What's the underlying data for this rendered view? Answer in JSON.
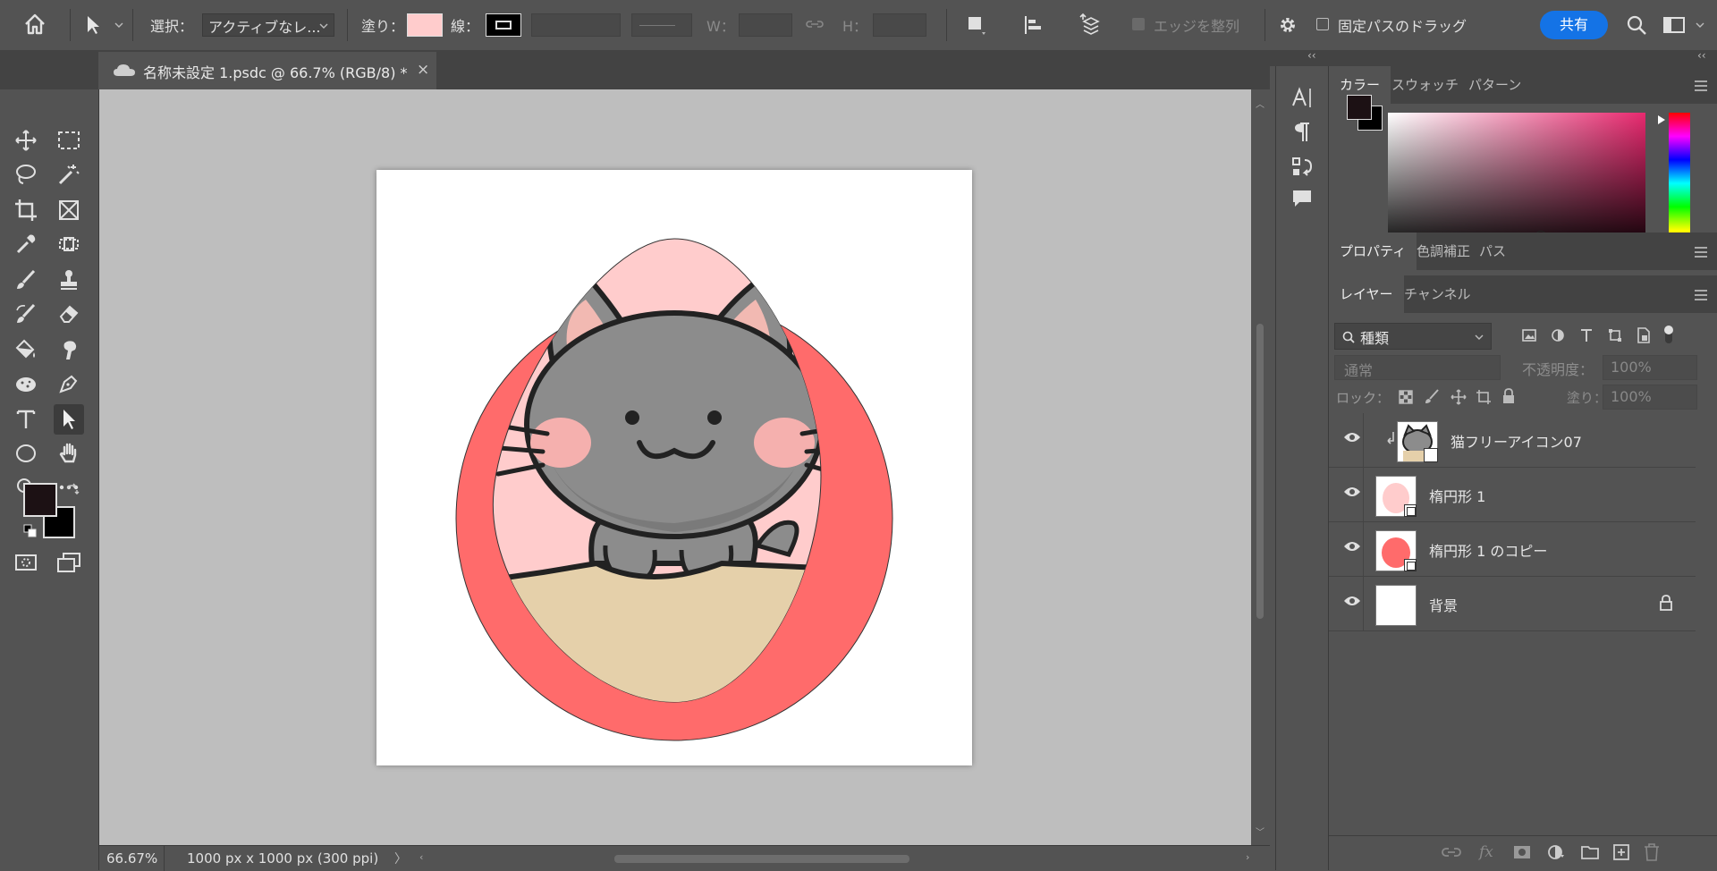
{
  "options_bar": {
    "select_label": "選択：",
    "select_value": "アクティブなレ...",
    "fill_label": "塗り：",
    "fill_color": "#ffcccc",
    "stroke_label": "線：",
    "w_label": "W：",
    "h_label": "H：",
    "align_edges_label": "エッジを整列",
    "constrain_path_label": "固定パスのドラッグ",
    "share_label": "共有"
  },
  "document": {
    "tab_title": "名称未設定 1.psdc @ 66.7% (RGB/8) *",
    "close_glyph": "×"
  },
  "status": {
    "zoom": "66.67%",
    "doc_info": "1000 px x 1000 px (300 ppi)",
    "arrow": "〉"
  },
  "color_panel": {
    "tabs": [
      "カラー",
      "スウォッチ",
      "パターン"
    ],
    "foreground": "#1c1114",
    "background": "#000000",
    "hue_color": "#e8296f"
  },
  "properties_panel": {
    "tabs": [
      "プロパティ",
      "色調補正",
      "パス"
    ]
  },
  "layers_panel": {
    "tabs": [
      "レイヤー",
      "チャンネル"
    ],
    "filter_label": "種類",
    "blend_mode": "通常",
    "opacity_label": "不透明度：",
    "opacity_value": "100%",
    "lock_label": "ロック：",
    "fill_label": "塗り：",
    "fill_value": "100%",
    "layers": [
      {
        "name": "猫フリーアイコン07",
        "clipped": true
      },
      {
        "name": "楕円形 1"
      },
      {
        "name": "楕円形 1 のコピー"
      },
      {
        "name": "背景",
        "locked": true
      }
    ]
  },
  "tools": [
    "move-tool",
    "marquee-tool",
    "lasso-tool",
    "magic-wand-tool",
    "crop-tool",
    "frame-tool",
    "eyedropper-tool",
    "spot-heal-tool",
    "brush-tool",
    "stamp-tool",
    "history-brush-tool",
    "eraser-tool",
    "paint-bucket-tool",
    "smudge-tool",
    "sponge-tool",
    "pen-tool",
    "type-tool",
    "direct-selection-tool",
    "ellipse-tool",
    "hand-tool",
    "zoom-tool",
    "more-tools"
  ],
  "colors": {
    "accent_blue": "#1473e6",
    "egg_outer": "#ff6b6b",
    "egg_inner": "#ffcccc",
    "cat_gray": "#8c8c8c",
    "box_tan": "#e5d0aa"
  }
}
